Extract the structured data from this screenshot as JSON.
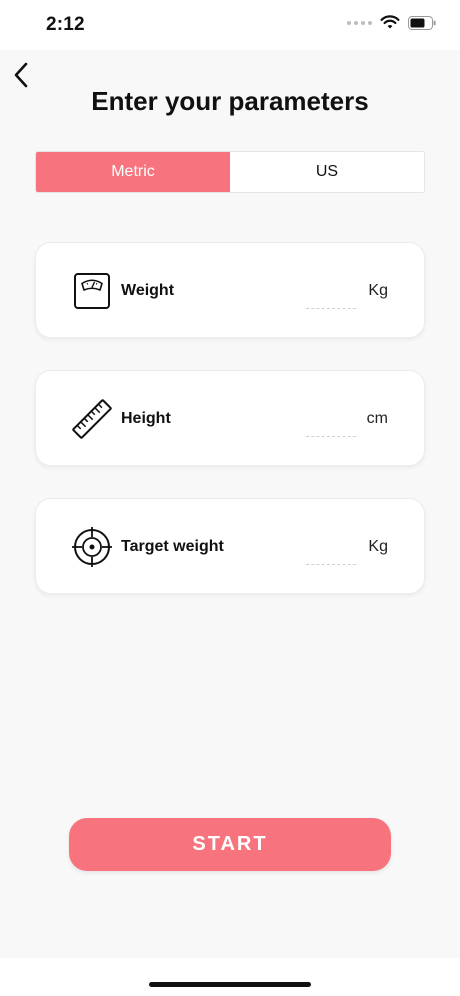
{
  "status_bar": {
    "time": "2:12",
    "icons": [
      "cellular-dots-icon",
      "wifi-icon",
      "battery-icon"
    ]
  },
  "header": {
    "back_icon": "chevron-left-icon",
    "title": "Enter your parameters"
  },
  "unit_toggle": {
    "options": [
      {
        "label": "Metric",
        "selected": true
      },
      {
        "label": "US",
        "selected": false
      }
    ]
  },
  "parameters": [
    {
      "label": "Weight",
      "value": "",
      "unit": "Kg",
      "icon": "scale-icon"
    },
    {
      "label": "Height",
      "value": "",
      "unit": "cm",
      "icon": "ruler-icon"
    },
    {
      "label": "Target weight",
      "value": "",
      "unit": "Kg",
      "icon": "target-icon"
    }
  ],
  "start_button": {
    "label": "START"
  },
  "colors": {
    "accent": "#f7747f",
    "background": "#f8f8f8",
    "card": "#ffffff",
    "text": "#111111"
  }
}
